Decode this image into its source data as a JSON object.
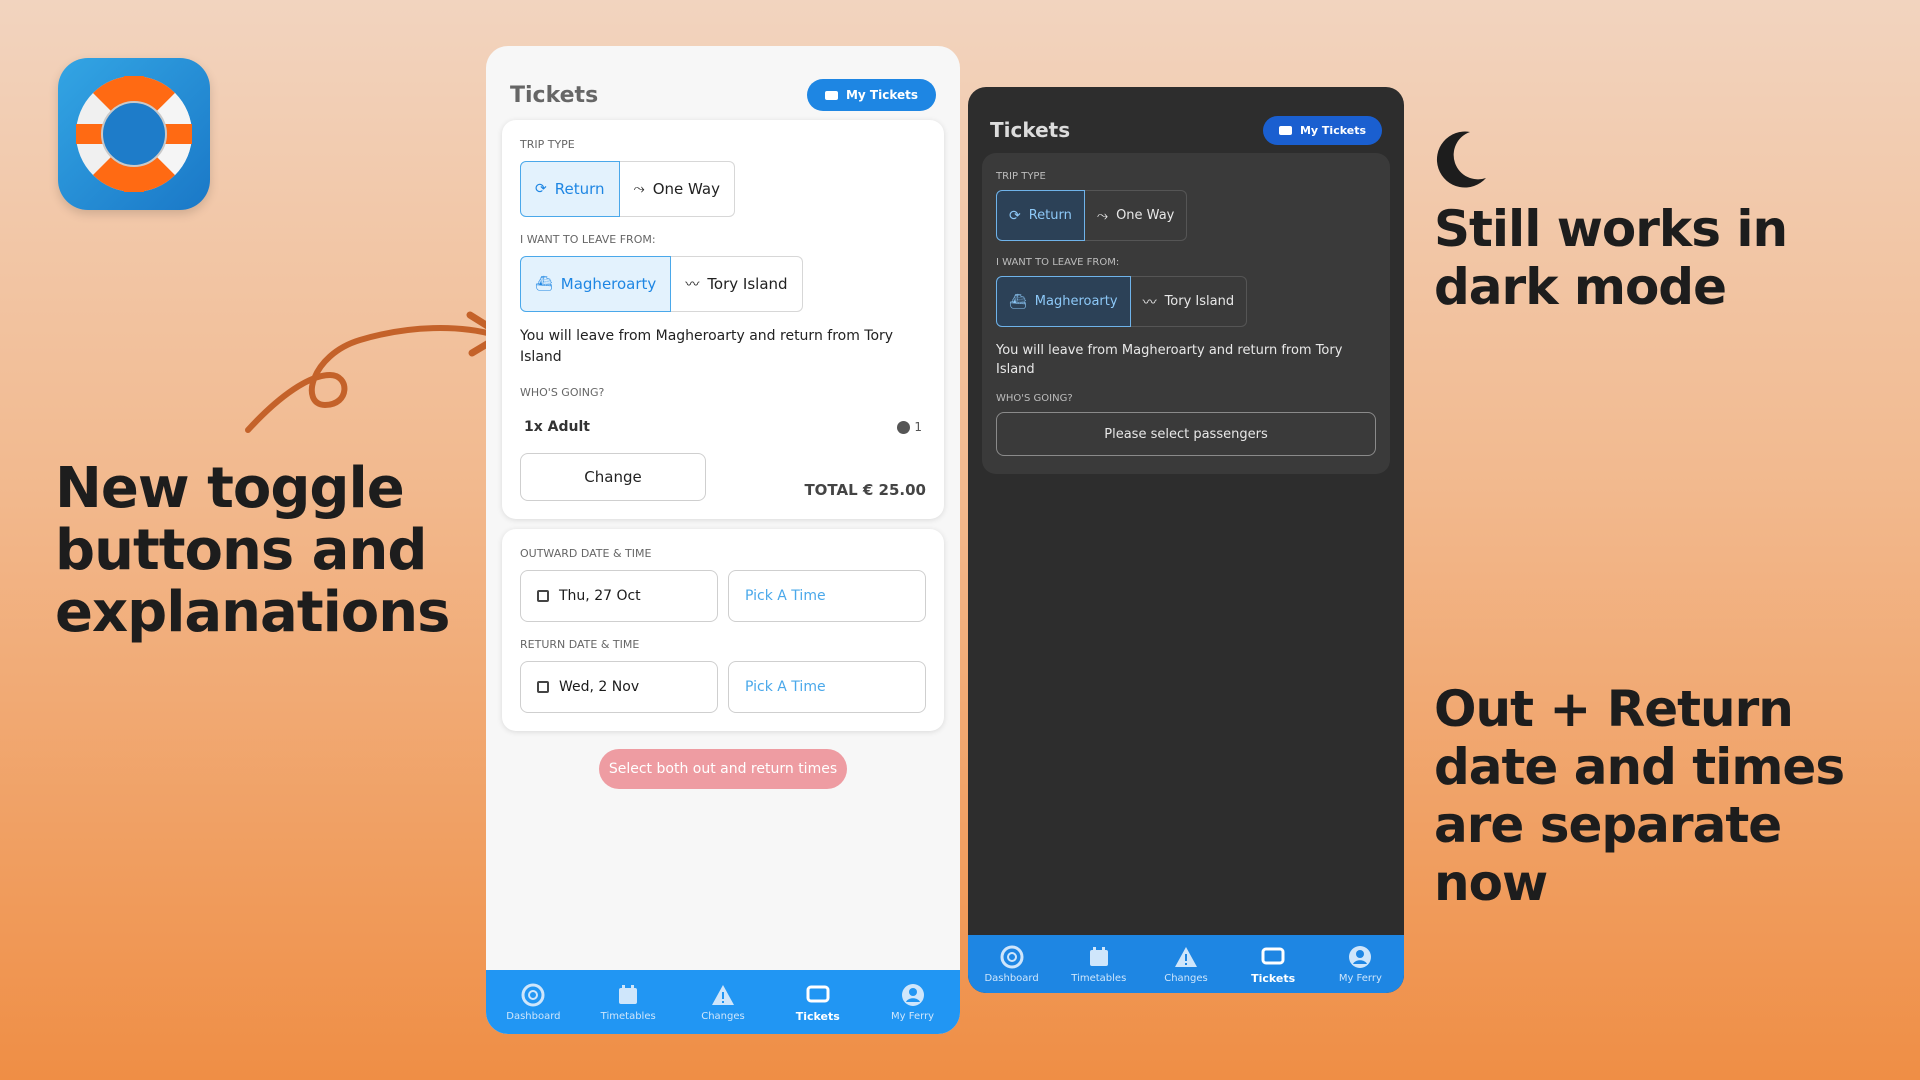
{
  "colors": {
    "accent": "#1e86e3",
    "nav_bar": "#2196f3",
    "disabled_button": "#ee9ca2",
    "dark_bg": "#2d2d2d"
  },
  "headlines": {
    "left": "New toggle buttons and explanations",
    "dark": "Still works in dark mode",
    "out": "Out + Return date and times are separate now"
  },
  "light": {
    "title": "Tickets",
    "my_tickets": "My Tickets",
    "trip_type_label": "TRIP TYPE",
    "trip_types": [
      "Return",
      "One Way"
    ],
    "leave_label": "I WANT TO LEAVE FROM:",
    "leave_options": [
      "Magheroarty",
      "Tory Island"
    ],
    "explanation": "You will leave from Magheroarty and return from Tory Island",
    "whos_going_label": "WHO'S GOING?",
    "passenger": "1x Adult",
    "passenger_count": "1",
    "change_label": "Change",
    "total": "TOTAL € 25.00",
    "outward_label": "OUTWARD DATE & TIME",
    "outward_date": "Thu, 27 Oct",
    "outward_time": "Pick A Time",
    "return_label": "RETURN DATE & TIME",
    "return_date": "Wed, 2 Nov",
    "return_time": "Pick A Time",
    "submit": "Select both out and return times"
  },
  "dark": {
    "title": "Tickets",
    "my_tickets": "My Tickets",
    "trip_type_label": "TRIP TYPE",
    "trip_types": [
      "Return",
      "One Way"
    ],
    "leave_label": "I WANT TO LEAVE FROM:",
    "leave_options": [
      "Magheroarty",
      "Tory Island"
    ],
    "explanation": "You will leave from Magheroarty and return from Tory Island",
    "whos_going_label": "WHO'S GOING?",
    "passengers_button": "Please select passengers"
  },
  "nav": [
    "Dashboard",
    "Timetables",
    "Changes",
    "Tickets",
    "My Ferry"
  ]
}
